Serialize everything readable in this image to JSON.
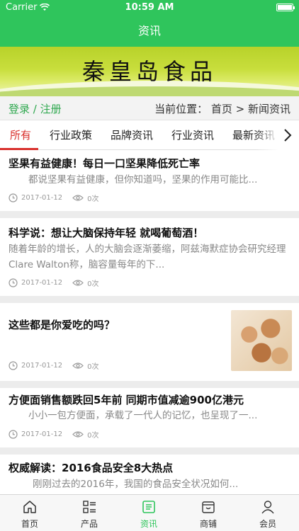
{
  "status": {
    "carrier": "Carrier",
    "time": "10:59 AM"
  },
  "nav": {
    "title": "资讯"
  },
  "banner": {
    "title": "秦皇岛食品"
  },
  "location": {
    "login": "登录 / 注册",
    "breadcrumb": "当前位置： 首页 > 新闻资讯"
  },
  "tabs": [
    "所有",
    "行业政策",
    "品牌资讯",
    "行业资讯",
    "最新资讯"
  ],
  "articles": [
    {
      "title": "坚果有益健康！每日一口坚果降低死亡率",
      "desc": "都说坚果有益健康，但你知道吗，坚果的作用可能比...",
      "date": "2017-01-12",
      "views": "0次"
    },
    {
      "title": "科学说：想让大脑保持年轻 就喝葡萄酒！",
      "desc": "随着年龄的增长，人的大脑会逐渐萎缩，阿兹海默症协会研究经理Clare Walton称，脑容量每年的下...",
      "date": "2017-01-12",
      "views": "0次"
    },
    {
      "title": "这些都是你爱吃的吗？",
      "desc": "",
      "date": "2017-01-12",
      "views": "0次"
    },
    {
      "title": "方便面销售额跌回5年前 同期市值减逾900亿港元",
      "desc": "小小一包方便面，承载了一代人的记忆，也呈现了一...",
      "date": "2017-01-12",
      "views": "0次"
    },
    {
      "title": "权威解读：2016食品安全8大热点",
      "desc": "刚刚过去的2016年，我国的食品安全状况如何...",
      "date": "",
      "views": ""
    }
  ],
  "bottom_nav": [
    "首页",
    "产品",
    "资讯",
    "商铺",
    "会员"
  ],
  "colors": {
    "brand_green": "#2fc55c",
    "tab_active_red": "#d9302c",
    "login_green": "#2fa84f"
  }
}
